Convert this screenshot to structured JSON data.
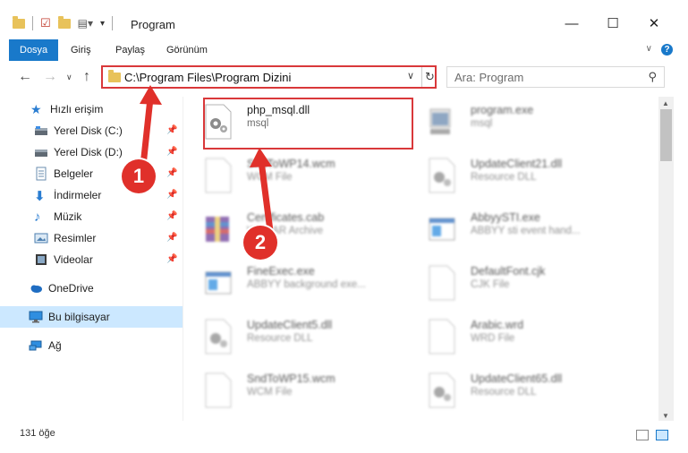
{
  "window": {
    "title": "Program"
  },
  "ribbon": {
    "tabs": [
      "Dosya",
      "Giriş",
      "Paylaş",
      "Görünüm"
    ]
  },
  "address": {
    "path": "C:\\Program Files\\Program Dizini"
  },
  "search": {
    "placeholder": "Ara: Program"
  },
  "sidebar": {
    "items": [
      {
        "label": "Hızlı erişim",
        "icon": "star-icon"
      },
      {
        "label": "Yerel Disk (C:)",
        "icon": "drive-icon",
        "pinned": true
      },
      {
        "label": "Yerel Disk (D:)",
        "icon": "drive-icon",
        "pinned": true
      },
      {
        "label": "Belgeler",
        "icon": "documents-icon",
        "pinned": true
      },
      {
        "label": "İndirmeler",
        "icon": "download-icon",
        "pinned": true
      },
      {
        "label": "Müzik",
        "icon": "music-icon",
        "pinned": true
      },
      {
        "label": "Resimler",
        "icon": "pictures-icon",
        "pinned": true
      },
      {
        "label": "Videolar",
        "icon": "videos-icon",
        "pinned": true
      },
      {
        "label": "OneDrive",
        "icon": "cloud-icon"
      },
      {
        "label": "Bu bilgisayar",
        "icon": "computer-icon",
        "selected": true
      },
      {
        "label": "Ağ",
        "icon": "network-icon"
      }
    ]
  },
  "files": [
    {
      "name": "php_msql.dll",
      "desc": "msql",
      "icon": "dll-gear-icon"
    },
    {
      "name": "program.exe",
      "desc": "msql",
      "icon": "exe-icon"
    },
    {
      "name": "SndToWP14.wcm",
      "desc": "WCM File",
      "icon": "blank-file-icon"
    },
    {
      "name": "UpdateClient21.dll",
      "desc": "Resource DLL",
      "icon": "dll-gear-icon"
    },
    {
      "name": "Certificates.cab",
      "desc": "WinRAR Archive",
      "icon": "archive-icon"
    },
    {
      "name": "AbbyySTI.exe",
      "desc": "ABBYY sti event hand...",
      "icon": "exe-window-icon"
    },
    {
      "name": "FineExec.exe",
      "desc": "ABBYY background exe...",
      "icon": "exe-window-icon"
    },
    {
      "name": "DefaultFont.cjk",
      "desc": "CJK File",
      "icon": "blank-file-icon"
    },
    {
      "name": "UpdateClient5.dll",
      "desc": "Resource DLL",
      "icon": "dll-gear-icon"
    },
    {
      "name": "Arabic.wrd",
      "desc": "WRD File",
      "icon": "blank-file-icon"
    },
    {
      "name": "SndToWP15.wcm",
      "desc": "WCM File",
      "icon": "blank-file-icon"
    },
    {
      "name": "UpdateClient65.dll",
      "desc": "Resource DLL",
      "icon": "dll-gear-icon"
    }
  ],
  "status": {
    "count": "131 öğe"
  },
  "callouts": [
    "1",
    "2"
  ],
  "colors": {
    "accent": "#1979ca",
    "highlight": "#d9383a",
    "selected": "#cce8ff"
  }
}
